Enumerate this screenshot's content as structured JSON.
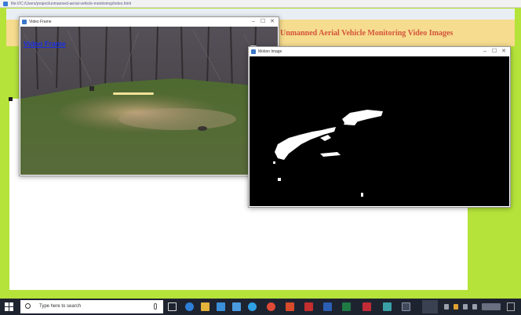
{
  "browser": {
    "address": "file:///C:/Users/project/unmanned-aerial-vehicle-monitoring/index.html"
  },
  "page": {
    "banner_title": "Unmanned Aerial Vehicle Monitoring Video Images",
    "link_text": "Video Frame"
  },
  "video_window": {
    "title": "Video Frame",
    "controls": [
      "–",
      "☐",
      "✕"
    ]
  },
  "mask_window": {
    "title": "Motion Image",
    "controls": [
      "–",
      "☐",
      "✕"
    ]
  },
  "taskbar": {
    "search_placeholder": "Type here to search",
    "icons": [
      "task-view-icon",
      "edge-icon",
      "file-explorer-icon",
      "store-icon",
      "mail-icon",
      "browser-icon",
      "chrome-icon",
      "office-icon",
      "pdf-icon",
      "word-icon",
      "excel-icon",
      "app-icon",
      "video-app-icon",
      "terminal-icon"
    ]
  },
  "colors": {
    "page_background": "#b5e33a",
    "banner_background": "#f6dc8e",
    "banner_text": "#d4543a",
    "link": "#1a2fe0",
    "taskbar": "#1e2330"
  }
}
